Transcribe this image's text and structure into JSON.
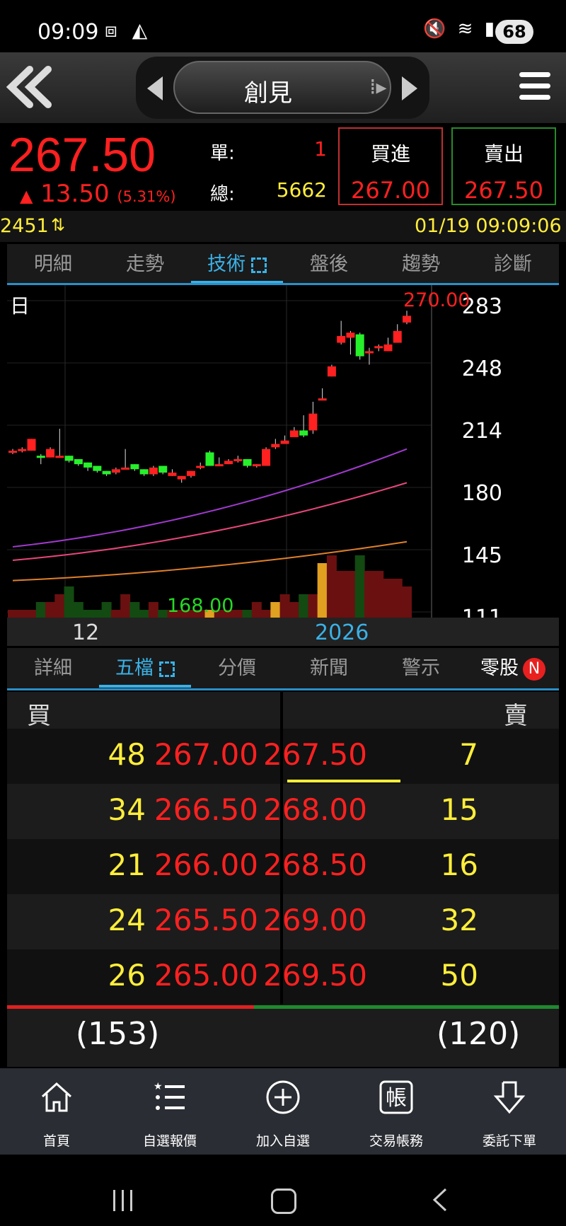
{
  "status": {
    "time": "09:09",
    "battery": "68"
  },
  "header": {
    "title": "創見"
  },
  "quote": {
    "price": "267.50",
    "change_arrow": "▲",
    "change": "13.50",
    "change_pct": "(5.31%)",
    "unit_label": "單:",
    "unit_value": "1",
    "total_label": "總:",
    "total_value": "5662",
    "buy_label": "買進",
    "buy_price": "267.00",
    "sell_label": "賣出",
    "sell_price": "267.50"
  },
  "codebar": {
    "code": "2451",
    "datetime": "01/19 09:09:06"
  },
  "tabs1": [
    "明細",
    "走勢",
    "技術",
    "盤後",
    "趨勢",
    "診斷"
  ],
  "tabs1_active": 2,
  "chart": {
    "period_label": "日",
    "high_label": "270.00",
    "low_label": "168.00",
    "x_labels": [
      "12",
      "2026"
    ],
    "y_labels": [
      "283",
      "248",
      "214",
      "180",
      "145",
      "111"
    ]
  },
  "chart_data": {
    "type": "candlestick",
    "ylim": [
      111,
      283
    ],
    "candles": [
      [
        188,
        189,
        187,
        190
      ],
      [
        189,
        190,
        188,
        191
      ],
      [
        189,
        196,
        189,
        196
      ],
      [
        186,
        185,
        181,
        187
      ],
      [
        185,
        190,
        185,
        191
      ],
      [
        186,
        186,
        185,
        202
      ],
      [
        186,
        183,
        182,
        186
      ],
      [
        184,
        181,
        180,
        184
      ],
      [
        182,
        179,
        177,
        182
      ],
      [
        180,
        177,
        176,
        180
      ],
      [
        177,
        175,
        174,
        177
      ],
      [
        176,
        178,
        175,
        179
      ],
      [
        179,
        179,
        178,
        190
      ],
      [
        181,
        178,
        177,
        181
      ],
      [
        178,
        175,
        174,
        178
      ],
      [
        175,
        179,
        174,
        180
      ],
      [
        180,
        176,
        175,
        180
      ],
      [
        174,
        176,
        174,
        178
      ],
      [
        172,
        174,
        170,
        174
      ],
      [
        174,
        177,
        173,
        177
      ],
      [
        180,
        180,
        178,
        182
      ],
      [
        188,
        180,
        180,
        189
      ],
      [
        181,
        181,
        180,
        185
      ],
      [
        181,
        183,
        181,
        184
      ],
      [
        184,
        184,
        182,
        186
      ],
      [
        184,
        180,
        179,
        184
      ],
      [
        181,
        181,
        179,
        181
      ],
      [
        180,
        190,
        180,
        191
      ],
      [
        191,
        193,
        190,
        196
      ],
      [
        193,
        195,
        193,
        198
      ],
      [
        197,
        201,
        197,
        203
      ],
      [
        201,
        198,
        197,
        210
      ],
      [
        201,
        211,
        199,
        218
      ],
      [
        220,
        220,
        219,
        226
      ],
      [
        233,
        239,
        233,
        240
      ],
      [
        253,
        257,
        252,
        266
      ],
      [
        256,
        259,
        246,
        260
      ],
      [
        258,
        245,
        243,
        259
      ],
      [
        248,
        248,
        240,
        250
      ],
      [
        251,
        251,
        248,
        252
      ],
      [
        248,
        252,
        248,
        256
      ],
      [
        253,
        260,
        253,
        264
      ],
      [
        265,
        269,
        264,
        272
      ]
    ],
    "ma_series": [
      {
        "color": "#a23ad0",
        "values_start": 132,
        "values_end": 190
      },
      {
        "color": "#e8467a",
        "values_start": 124,
        "values_end": 170
      },
      {
        "color": "#e0802a",
        "values_start": 112,
        "values_end": 135
      }
    ],
    "volume": [
      1,
      1,
      1,
      2,
      2,
      3,
      4,
      2,
      1,
      1,
      2,
      1,
      3,
      2,
      1,
      2,
      1,
      1,
      1,
      1,
      1,
      1,
      1,
      1,
      1,
      1,
      2,
      1,
      2,
      3,
      2,
      3,
      3,
      7,
      8,
      6,
      6,
      8,
      6,
      6,
      5,
      5,
      4
    ]
  },
  "tabs2": [
    "詳細",
    "五檔",
    "分價",
    "新聞",
    "警示",
    "零股"
  ],
  "tabs2_active": 1,
  "tabs2_badge": "N",
  "book": {
    "buy_header": "買",
    "sell_header": "賣",
    "rows": [
      {
        "bid_qty": "48",
        "bid": "267.00",
        "ask": "267.50",
        "ask_qty": "7"
      },
      {
        "bid_qty": "34",
        "bid": "266.50",
        "ask": "268.00",
        "ask_qty": "15"
      },
      {
        "bid_qty": "21",
        "bid": "266.00",
        "ask": "268.50",
        "ask_qty": "16"
      },
      {
        "bid_qty": "24",
        "bid": "265.50",
        "ask": "269.00",
        "ask_qty": "32"
      },
      {
        "bid_qty": "26",
        "bid": "265.00",
        "ask": "269.50",
        "ask_qty": "50"
      }
    ],
    "bid_total": "(153)",
    "ask_total": "(120)",
    "bid_ratio": 0.56
  },
  "nav": [
    {
      "label": "首頁",
      "icon": "home-icon"
    },
    {
      "label": "自選報價",
      "icon": "watchlist-icon"
    },
    {
      "label": "加入自選",
      "icon": "add-circle-icon"
    },
    {
      "label": "交易帳務",
      "icon": "account-icon"
    },
    {
      "label": "委託下單",
      "icon": "order-icon"
    }
  ],
  "colors": {
    "up": "#ff2020",
    "down": "#26d926",
    "accent": "#3ab1e6",
    "highlight": "#ffee3a"
  }
}
